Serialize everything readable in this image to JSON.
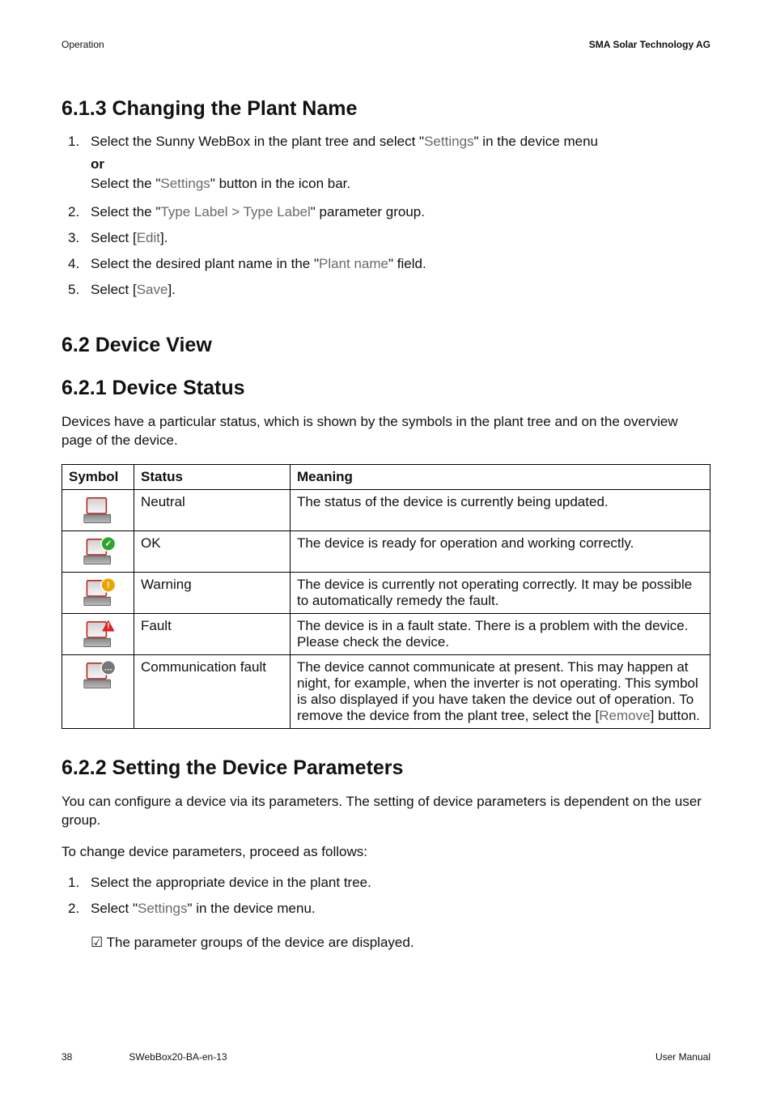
{
  "header": {
    "left": "Operation",
    "right": "SMA Solar Technology AG"
  },
  "s613": {
    "title": "6.1.3 Changing the Plant Name",
    "step1a": "Select the Sunny WebBox in the plant tree and select \"",
    "step1_ui1": "Settings",
    "step1b": "\" in the device menu",
    "or": "or",
    "step1c_a": "Select the \"",
    "step1c_ui": "Settings",
    "step1c_b": "\" button in the icon bar.",
    "step2a": "Select the \"",
    "step2_ui": "Type Label > Type Label",
    "step2b": "\" parameter group.",
    "step3a": "Select [",
    "step3_ui": "Edit",
    "step3b": "].",
    "step4a": "Select the desired plant name in the \"",
    "step4_ui": "Plant name",
    "step4b": "\" field.",
    "step5a": "Select [",
    "step5_ui": "Save",
    "step5b": "]."
  },
  "s62": {
    "title": "6.2 Device View"
  },
  "s621": {
    "title": "6.2.1 Device Status",
    "intro": "Devices have a particular status, which is shown by the symbols in the plant tree and on the overview page of the device.",
    "th_symbol": "Symbol",
    "th_status": "Status",
    "th_meaning": "Meaning",
    "rows": [
      {
        "status": "Neutral",
        "meaning": "The status of the device is currently being updated."
      },
      {
        "status": "OK",
        "meaning": "The device is ready for operation and working correctly."
      },
      {
        "status": "Warning",
        "meaning": "The device is currently not operating correctly. It may be possible to automatically remedy the fault."
      },
      {
        "status": "Fault",
        "meaning": "The device is in a fault state. There is a problem with the device. Please check the device."
      },
      {
        "status": "Communication fault",
        "meaning_a": "The device cannot communicate at present. This may happen at night, for example, when the inverter is not operating. This symbol is also displayed if you have taken the device out of operation. To remove the device from the plant tree, select the [",
        "meaning_ui": "Remove",
        "meaning_b": "] button."
      }
    ]
  },
  "s622": {
    "title": "6.2.2 Setting the Device Parameters",
    "intro1": "You can configure a device via its parameters. The setting of device parameters is dependent on the user group.",
    "intro2": "To change device parameters, proceed as follows:",
    "step1": "Select the appropriate device in the plant tree.",
    "step2a": "Select \"",
    "step2_ui": "Settings",
    "step2b": "\" in the device menu.",
    "result": "The parameter groups of the device are displayed."
  },
  "footer": {
    "page": "38",
    "docid": "SWebBox20-BA-en-13",
    "kind": "User Manual"
  }
}
